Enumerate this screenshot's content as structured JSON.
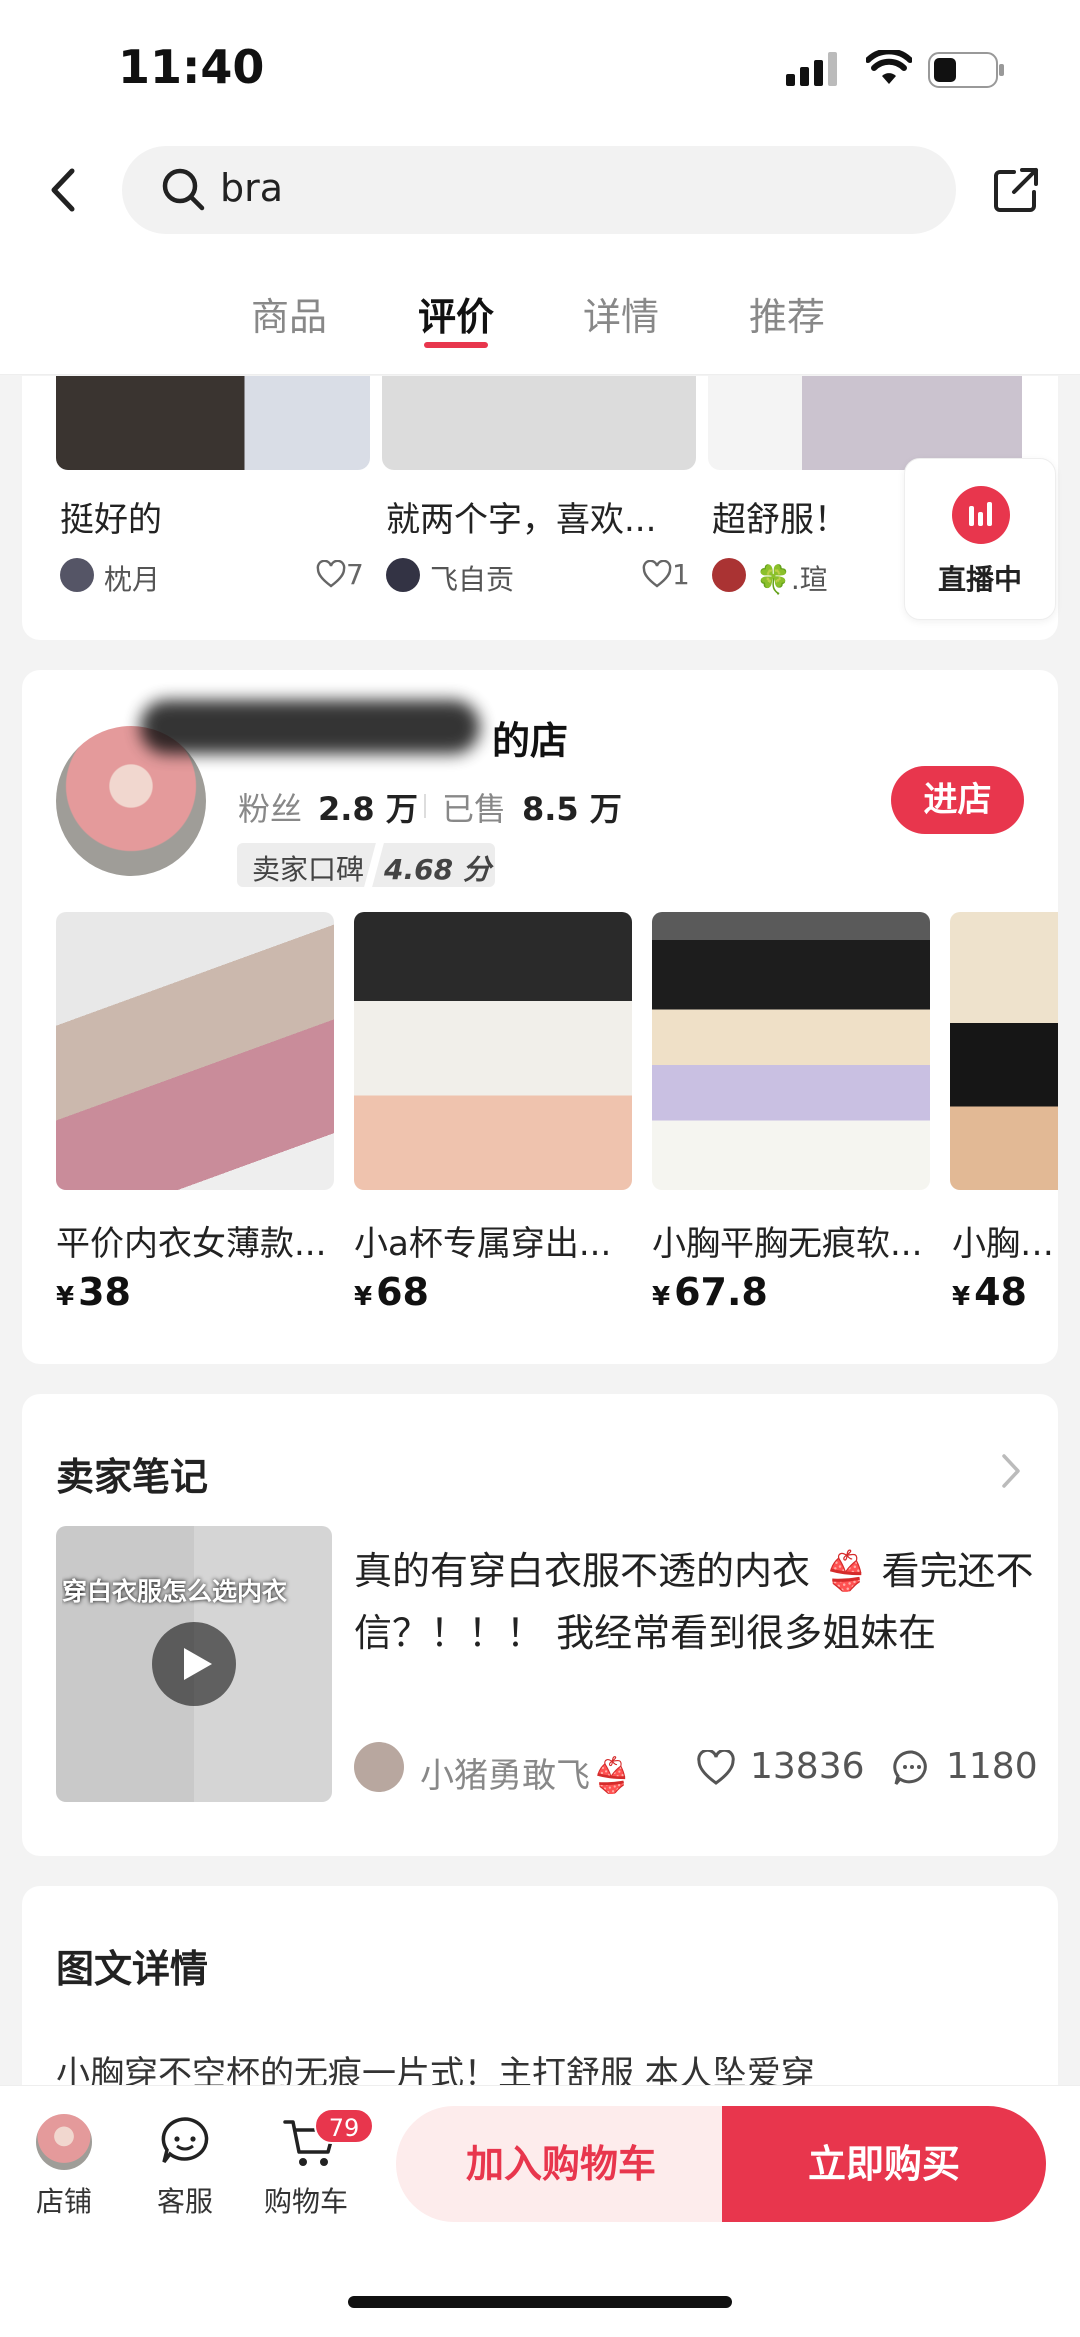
{
  "status_bar": {
    "time": "11:40"
  },
  "search": {
    "query": "bra"
  },
  "tabs": [
    {
      "label": "商品",
      "active": false
    },
    {
      "label": "评价",
      "active": true
    },
    {
      "label": "详情",
      "active": false
    },
    {
      "label": "推荐",
      "active": false
    }
  ],
  "reviews": [
    {
      "text": "挺好的",
      "user": "枕月",
      "likes": "7"
    },
    {
      "text": "就两个字，喜欢...",
      "user": "飞自贡",
      "likes": "1"
    },
    {
      "text": "超舒服！",
      "user": "🍀.瑄",
      "likes": ""
    }
  ],
  "live": {
    "label": "直播中"
  },
  "shop": {
    "name_suffix": "的店",
    "fans_label": "粉丝",
    "fans_value": "2.8 万",
    "sold_label": "已售",
    "sold_value": "8.5 万",
    "rating_label": "卖家口碑",
    "rating_value": "4.68 分",
    "enter_label": "进店",
    "products": [
      {
        "title": "平价内衣女薄款...",
        "currency": "¥",
        "price": "38"
      },
      {
        "title": "小a杯专属穿出...",
        "currency": "¥",
        "price": "68"
      },
      {
        "title": "小胸平胸无痕软...",
        "currency": "¥",
        "price": "67.8"
      },
      {
        "title": "小胸专...",
        "currency": "¥",
        "price": "48"
      }
    ]
  },
  "notes": {
    "title": "卖家笔记",
    "cover_caption": "穿白衣服怎么选内衣",
    "text": "真的有穿白衣服不透的内衣 👙 看完还不信？！！！ 我经常看到很多姐妹在",
    "user": "小猪勇敢飞👙",
    "likes": "13836",
    "comments": "1180"
  },
  "details": {
    "title": "图文详情",
    "text": "小胸穿不空杯的无痕一片式！主打舒服 本人坠爱穿"
  },
  "bottom_bar": {
    "shop_label": "店铺",
    "service_label": "客服",
    "cart_label": "购物车",
    "cart_count": "79",
    "add_cart_label": "加入购物车",
    "buy_label": "立即购买"
  },
  "colors": {
    "accent": "#e8364d",
    "background": "#f3f3f3"
  }
}
